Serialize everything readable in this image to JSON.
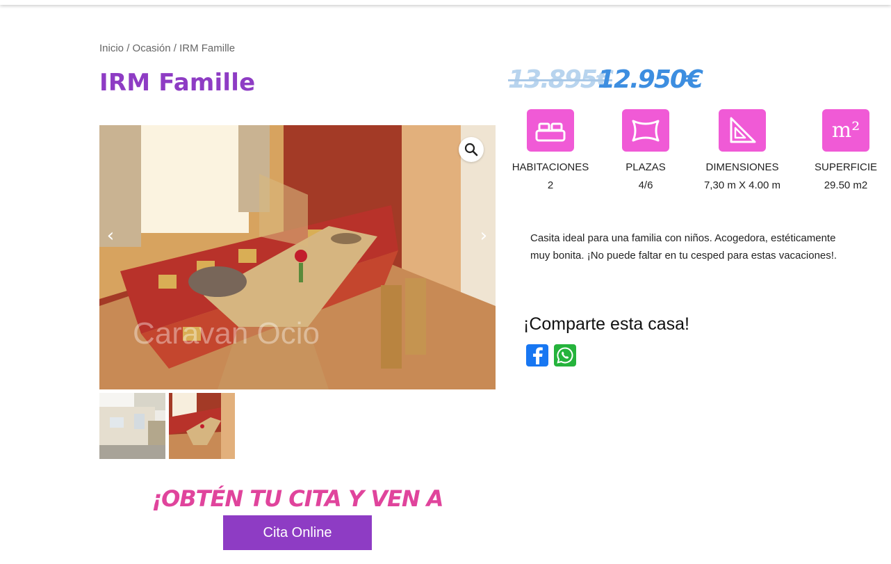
{
  "breadcrumb": {
    "home": "Inicio",
    "sep1": " / ",
    "category": "Ocasión",
    "sep2": " / ",
    "current": "IRM Famille"
  },
  "title": "IRM Famille",
  "price": {
    "old": "13.895€",
    "new": "12.950€"
  },
  "gallery": {
    "watermark": "Caravan Ocio"
  },
  "specs": [
    {
      "icon": "bed-icon",
      "label": "HABITACIONES",
      "value": "2"
    },
    {
      "icon": "pillow-icon",
      "label": "PLAZAS",
      "value": "4/6"
    },
    {
      "icon": "set-square-icon",
      "label": "DIMENSIONES",
      "value": "7,30 m X 4.00 m"
    },
    {
      "icon": "square-meters-icon",
      "label": "SUPERFICIE",
      "value": "29.50 m2",
      "icon_text": "m²"
    }
  ],
  "description": "Casita ideal para una familia con niños. Acogedora, estéticamente muy bonita. ¡No puede faltar en tu cesped para estas vacaciones!.",
  "share": {
    "title": "¡Comparte esta casa!"
  },
  "cta": {
    "title": "¡OBTÉN TU CITA Y VEN A VISITARLA!",
    "button": "Cita Online"
  },
  "colors": {
    "brand_purple": "#8e3cc4",
    "icon_pink": "#f05ad6",
    "price_blue": "#3d8ee0",
    "cta_pink": "#e0449c"
  }
}
